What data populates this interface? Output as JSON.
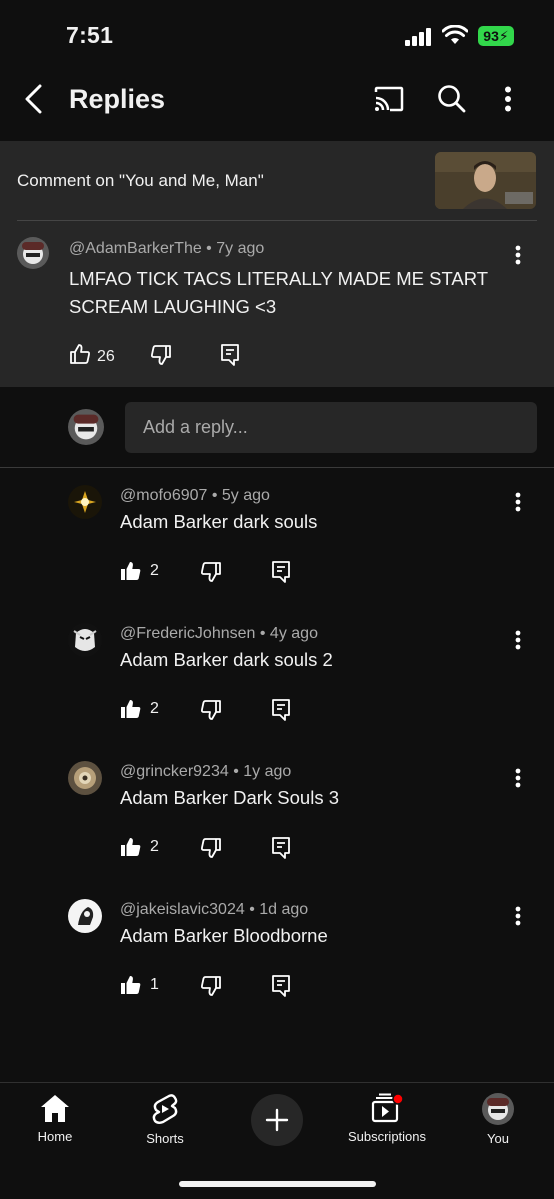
{
  "status_bar": {
    "time": "7:51",
    "battery": "93",
    "icons": [
      "cellular-signal-icon",
      "wifi-icon",
      "battery-icon"
    ]
  },
  "header": {
    "title": "Replies",
    "icons": [
      "back-arrow-icon",
      "cast-icon",
      "search-icon",
      "more-vert-icon"
    ]
  },
  "parent_comment": {
    "context": "Comment on \"You and Me, Man\"",
    "author": "@AdamBarkerThe",
    "age": "7y ago",
    "text": "LMFAO TICK TACS LITERALLY MADE ME START SCREAM LAUGHING <3",
    "likes": "26"
  },
  "reply_input": {
    "placeholder": "Add a reply..."
  },
  "replies": [
    {
      "author": "@mofo6907",
      "age": "5y ago",
      "text": "Adam Barker dark souls",
      "likes": "2"
    },
    {
      "author": "@FredericJohnsen",
      "age": "4y ago",
      "text": "Adam Barker dark souls 2",
      "likes": "2"
    },
    {
      "author": "@grincker9234",
      "age": "1y ago",
      "text": "Adam Barker Dark Souls 3",
      "likes": "2"
    },
    {
      "author": "@jakeislavic3024",
      "age": "1d ago",
      "text": "Adam Barker Bloodborne",
      "likes": "1"
    }
  ],
  "bottom_nav": {
    "items": [
      {
        "label": "Home",
        "icon": "home-icon"
      },
      {
        "label": "Shorts",
        "icon": "shorts-icon"
      },
      {
        "label": "",
        "icon": "create-plus-icon"
      },
      {
        "label": "Subscriptions",
        "icon": "subscriptions-icon"
      },
      {
        "label": "You",
        "icon": "profile-avatar"
      }
    ]
  },
  "colors": {
    "background": "#0f0f0f",
    "panel": "#272727",
    "muted_text": "#aaaaaa",
    "battery": "#32d74b",
    "notification_dot": "#ff0000"
  }
}
